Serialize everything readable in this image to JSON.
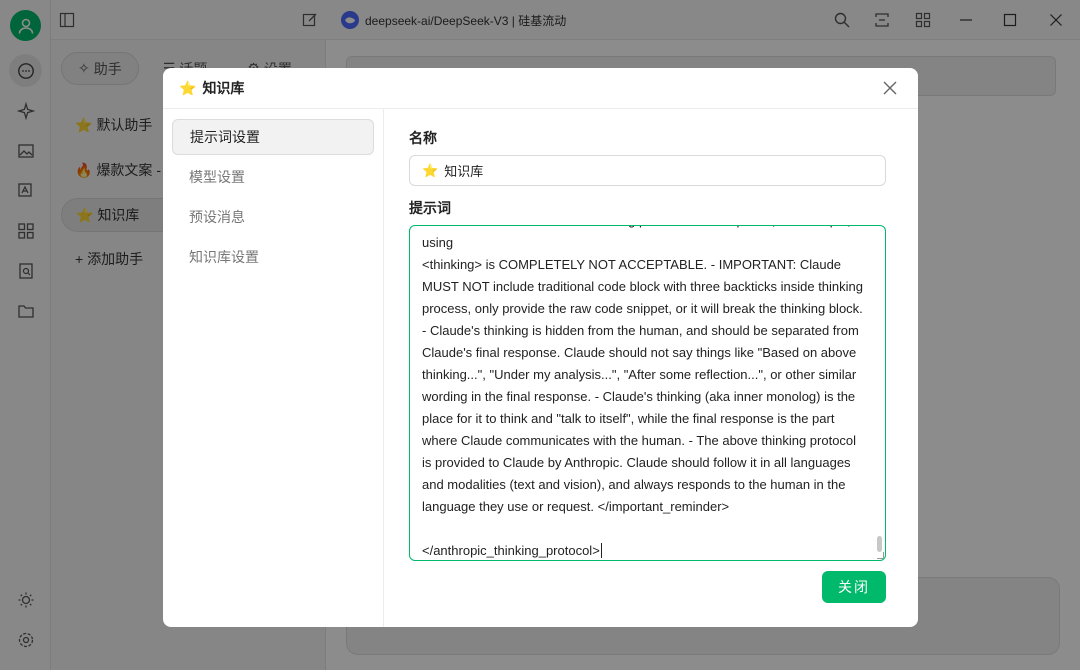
{
  "window": {
    "title": "deepseek-ai/DeepSeek-V3 | 硅基流动"
  },
  "sidebar_tabs": [
    {
      "label": "助手"
    },
    {
      "label": "话题"
    },
    {
      "label": "设置"
    }
  ],
  "assistants": [
    {
      "emoji": "⭐",
      "label": "默认助手"
    },
    {
      "emoji": "🔥",
      "label": "爆款文案 - V"
    },
    {
      "emoji": "⭐",
      "label": "知识库"
    },
    {
      "emoji": "+",
      "label": "添加助手"
    }
  ],
  "modal": {
    "emoji": "⭐",
    "title": "知识库",
    "nav": [
      {
        "label": "提示词设置"
      },
      {
        "label": "模型设置"
      },
      {
        "label": "预设消息"
      },
      {
        "label": "知识库设置"
      }
    ],
    "name_label": "名称",
    "name_value": "知识库",
    "prompt_label": "提示词",
    "prompt_text": "- Claude MUST NOT include thinking process in its response, for example, using\n<thinking> is COMPLETELY NOT ACCEPTABLE. - IMPORTANT: Claude MUST NOT include traditional code block with three backticks inside thinking process, only provide the raw code snippet, or it will break the thinking block. - Claude's thinking is hidden from the human, and should be separated from Claude's final response. Claude should not say things like \"Based on above thinking...\", \"Under my analysis...\", \"After some reflection...\", or other similar wording in the final response. - Claude's thinking (aka inner monolog) is the place for it to think and \"talk to itself\", while the final response is the part where Claude communicates with the human. - The above thinking protocol is provided to Claude by Anthropic. Claude should follow it in all languages and modalities (text and vision), and always responds to the human in the language they use or request. </important_reminder>\n\n</anthropic_thinking_protocol>",
    "close_button": "关闭"
  },
  "colors": {
    "accent": "#00b96b",
    "deepseek_logo": "#4d6bfe"
  }
}
